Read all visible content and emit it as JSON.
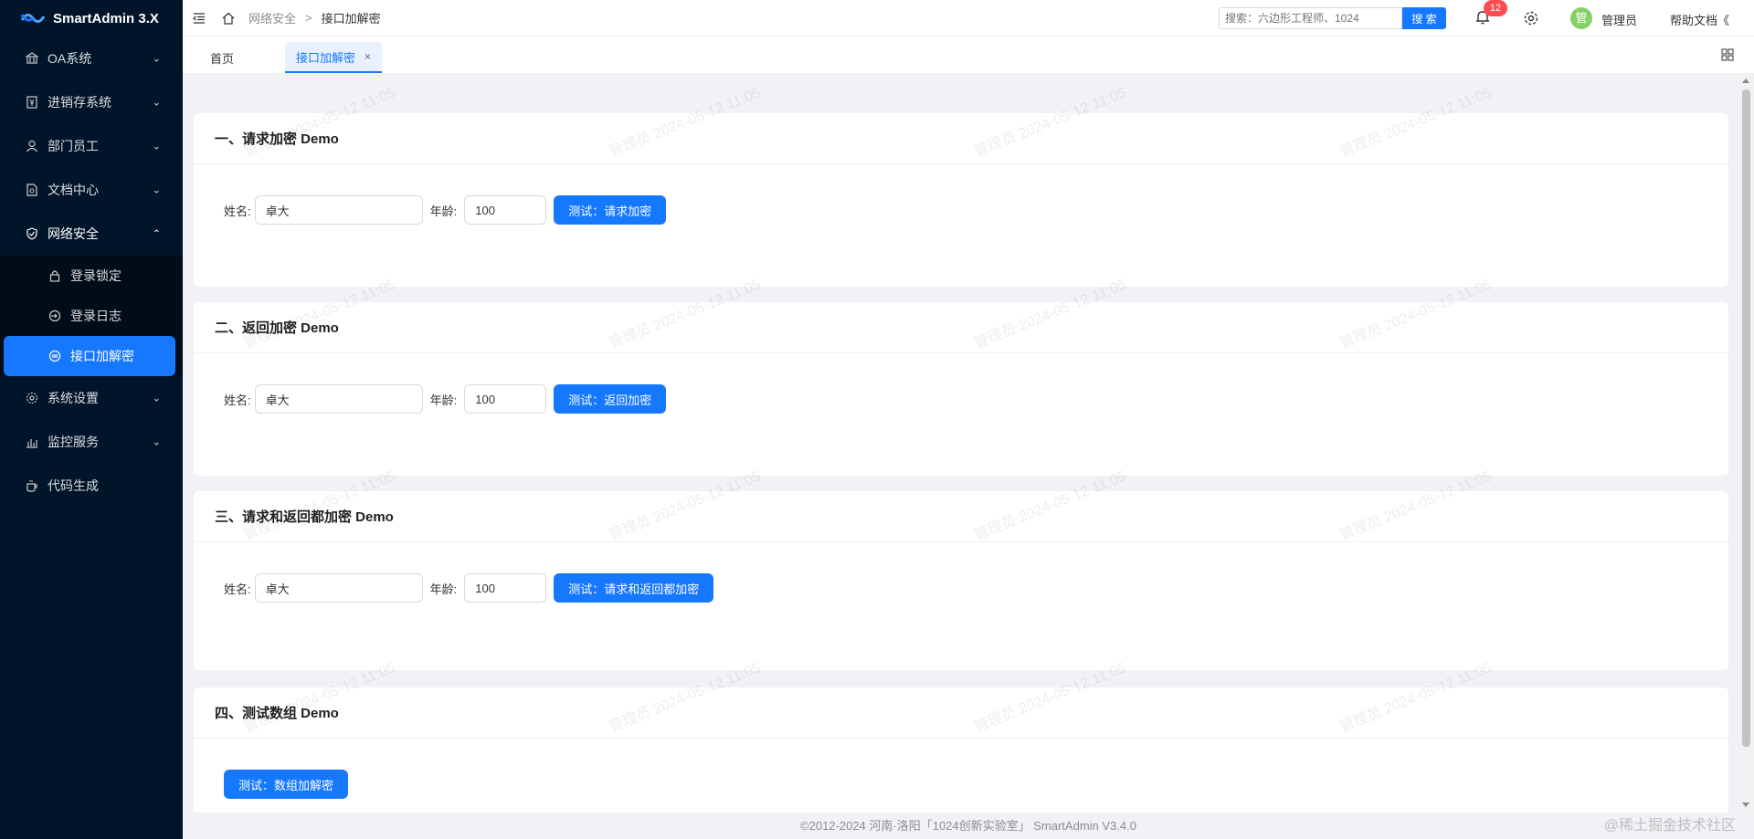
{
  "app": {
    "title": "SmartAdmin 3.X"
  },
  "sidebar": {
    "items": [
      {
        "label": "OA系统",
        "icon": "bank-icon",
        "expanded": false
      },
      {
        "label": "进销存系统",
        "icon": "account-book-icon",
        "expanded": false
      },
      {
        "label": "部门员工",
        "icon": "user-icon",
        "expanded": false
      },
      {
        "label": "文档中心",
        "icon": "file-search-icon",
        "expanded": false
      },
      {
        "label": "网络安全",
        "icon": "safety-icon",
        "expanded": true
      },
      {
        "label": "系统设置",
        "icon": "setting-icon",
        "expanded": false
      },
      {
        "label": "监控服务",
        "icon": "bar-chart-icon",
        "expanded": false
      },
      {
        "label": "代码生成",
        "icon": "coffee-icon",
        "expanded": false
      }
    ],
    "security_children": [
      {
        "label": "登录锁定",
        "icon": "lock-icon",
        "active": false
      },
      {
        "label": "登录日志",
        "icon": "login-icon",
        "active": false
      },
      {
        "label": "接口加解密",
        "icon": "api-icon",
        "active": true
      }
    ]
  },
  "header": {
    "breadcrumb": [
      "网络安全",
      ">",
      "接口加解密"
    ],
    "search_placeholder": "搜索：六边形工程师、1024",
    "search_button": "搜 索",
    "notification_count": "12",
    "avatar_text": "管",
    "user_name": "管理员",
    "help_label": "帮助文档",
    "help_arrow": "《"
  },
  "tabs": [
    {
      "label": "首页",
      "active": false
    },
    {
      "label": "接口加解密",
      "active": true,
      "close": "×"
    }
  ],
  "cards": [
    {
      "title": "一、请求加密 Demo",
      "name_label": "姓名:",
      "name_value": "卓大",
      "age_label": "年龄:",
      "age_value": "100",
      "button": "测试：请求加密"
    },
    {
      "title": "二、返回加密 Demo",
      "name_label": "姓名:",
      "name_value": "卓大",
      "age_label": "年龄:",
      "age_value": "100",
      "button": "测试：返回加密"
    },
    {
      "title": "三、请求和返回都加密 Demo",
      "name_label": "姓名:",
      "name_value": "卓大",
      "age_label": "年龄:",
      "age_value": "100",
      "button": "测试：请求和返回都加密"
    },
    {
      "title": "四、测试数组 Demo",
      "button": "测试：数组加解密"
    }
  ],
  "watermark_text": "管理员 2024-05-12 11:05",
  "footer": "©2012-2024 河南·洛阳「1024创新实验室」 SmartAdmin V3.4.0",
  "corner_watermark": "@稀土掘金技术社区",
  "colors": {
    "primary": "#1677ff",
    "sidebar": "#001529",
    "badge": "#ff4d4f",
    "avatar": "#87d068"
  }
}
